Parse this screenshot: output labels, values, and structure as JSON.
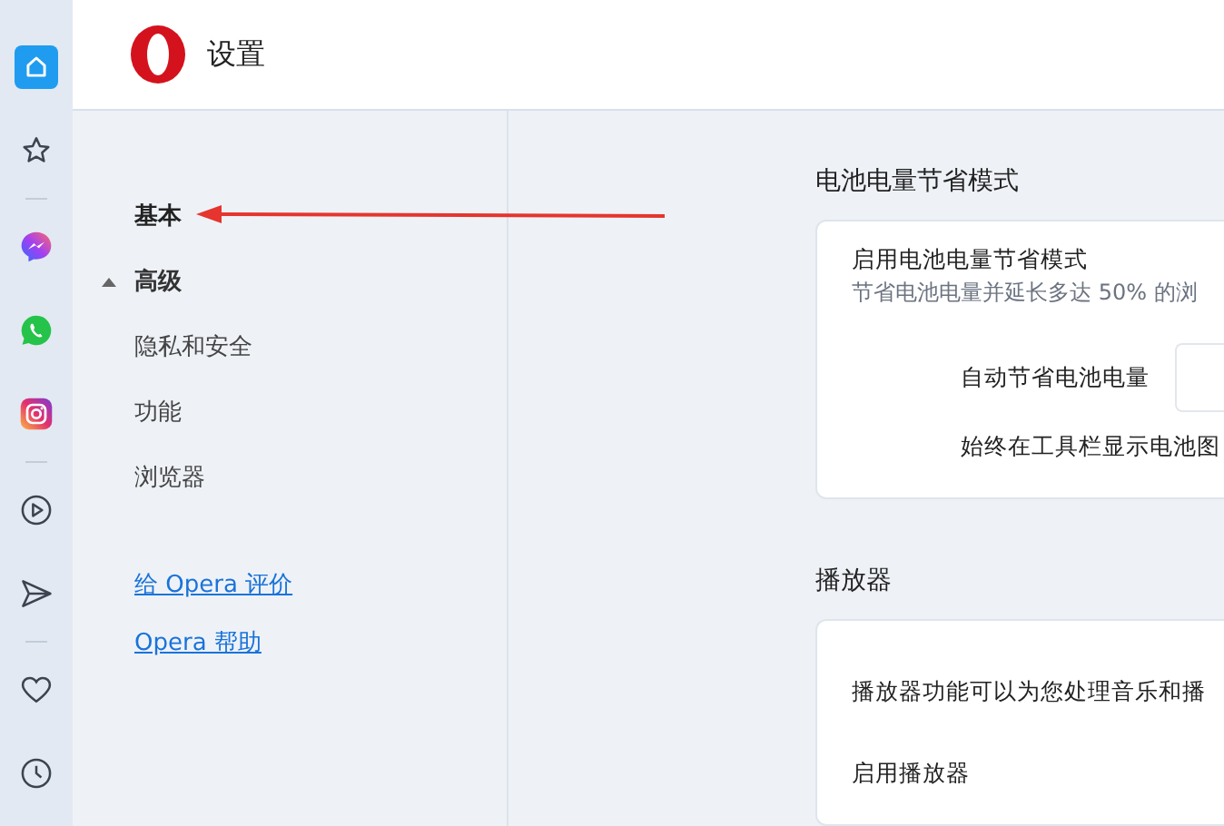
{
  "rail": [
    {
      "kind": "home",
      "selected": true
    },
    {
      "kind": "star",
      "selected": false
    },
    {
      "kind": "divider"
    },
    {
      "kind": "messenger",
      "selected": false
    },
    {
      "kind": "whatsapp",
      "selected": false
    },
    {
      "kind": "instagram",
      "selected": false
    },
    {
      "kind": "divider"
    },
    {
      "kind": "play",
      "selected": false
    },
    {
      "kind": "send",
      "selected": false
    },
    {
      "kind": "divider"
    },
    {
      "kind": "heart",
      "selected": false
    },
    {
      "kind": "clock",
      "selected": false
    }
  ],
  "header": {
    "title": "设置"
  },
  "sidebar": {
    "items": [
      {
        "kind": "item",
        "label": "基本",
        "selected": true
      },
      {
        "kind": "group",
        "label": "高级",
        "expanded": true,
        "children": [
          {
            "label": "隐私和安全",
            "selected": false
          },
          {
            "label": "功能",
            "selected": false
          },
          {
            "label": "浏览器",
            "selected": false
          }
        ]
      }
    ],
    "links": [
      "给 Opera 评价",
      "Opera 帮助"
    ]
  },
  "sections": [
    {
      "title": "电池电量节省模式",
      "rows": [
        {
          "kind": "toggle",
          "label": "启用电池电量节省模式",
          "description": "节省电池电量并延长多达 50% 的浏"
        },
        {
          "kind": "select",
          "label": "自动节省电池电量"
        },
        {
          "kind": "setting",
          "label": "始终在工具栏显示电池图"
        }
      ]
    },
    {
      "title": "播放器",
      "rows": [
        {
          "kind": "text",
          "label": "播放器功能可以为您处理音乐和播"
        },
        {
          "kind": "setting",
          "label": "启用播放器"
        }
      ]
    }
  ]
}
